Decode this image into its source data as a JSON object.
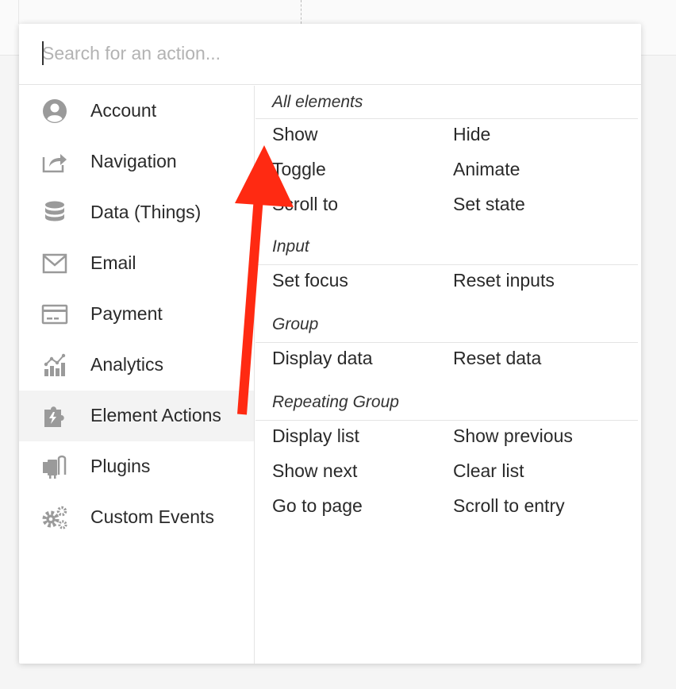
{
  "search": {
    "placeholder": "Search for an action..."
  },
  "sidebar": {
    "items": [
      {
        "label": "Account",
        "icon": "account-icon"
      },
      {
        "label": "Navigation",
        "icon": "navigation-icon"
      },
      {
        "label": "Data (Things)",
        "icon": "database-icon"
      },
      {
        "label": "Email",
        "icon": "email-icon"
      },
      {
        "label": "Payment",
        "icon": "credit-card-icon"
      },
      {
        "label": "Analytics",
        "icon": "analytics-icon"
      },
      {
        "label": "Element Actions",
        "icon": "puzzle-icon",
        "active": true
      },
      {
        "label": "Plugins",
        "icon": "plug-icon"
      },
      {
        "label": "Custom Events",
        "icon": "gears-icon"
      }
    ]
  },
  "main": {
    "sections": [
      {
        "title": "All elements",
        "actions": [
          "Show",
          "Hide",
          "Toggle",
          "Animate",
          "Scroll to",
          "Set state"
        ]
      },
      {
        "title": "Input",
        "actions": [
          "Set focus",
          "Reset inputs"
        ]
      },
      {
        "title": "Group",
        "actions": [
          "Display data",
          "Reset data"
        ]
      },
      {
        "title": "Repeating Group",
        "actions": [
          "Display list",
          "Show previous",
          "Show next",
          "Clear list",
          "Go to page",
          "Scroll to entry"
        ]
      }
    ]
  },
  "annotation": {
    "arrow_color": "#ff2a12"
  },
  "colors": {
    "icon_gray": "#9a9a9a",
    "border": "#e4e4e4"
  }
}
